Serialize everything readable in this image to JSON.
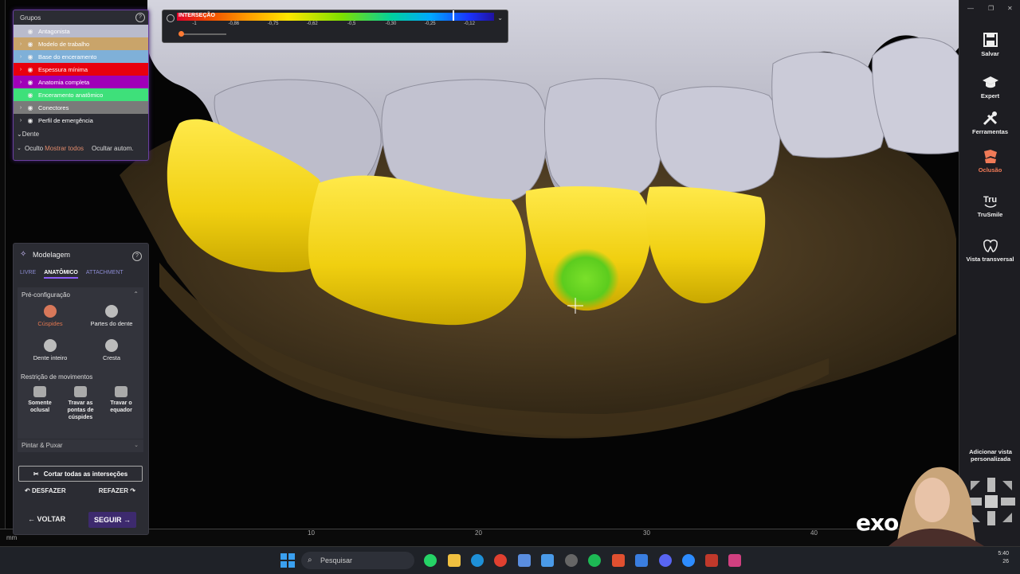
{
  "groups": {
    "title": "Grupos",
    "items": [
      {
        "label": "Antagonista",
        "color": "#b9bbcc",
        "expanded": false
      },
      {
        "label": "Modelo de trabalho",
        "color": "#c9a46a",
        "expanded": true
      },
      {
        "label": "Base do enceramento",
        "color": "#7fb0d8",
        "expanded": true
      },
      {
        "label": "Espessura mínima",
        "color": "#e8000e",
        "expanded": true
      },
      {
        "label": "Anatomia completa",
        "color": "#a000b8",
        "expanded": true
      },
      {
        "label": "Enceramento anatômico",
        "color": "#3ee07a",
        "expanded": false
      },
      {
        "label": "Conectores",
        "color": "#7a7a7a",
        "expanded": true
      },
      {
        "label": "Perfil de emergência",
        "color": "#2b2c33",
        "expanded": true
      }
    ],
    "dente": "Dente",
    "oculto": "Oculto",
    "show_all": "Mostrar todos",
    "auto_hide": "Ocultar autom."
  },
  "colorbar": {
    "label": "INTERSEÇÃO",
    "ticks": [
      "-1",
      "-0,86",
      "-0,75",
      "-0,62",
      "-0,5",
      "-0,30",
      "-0,25",
      "-0,12"
    ],
    "slider_value": 0.05
  },
  "modelagem": {
    "title": "Modelagem",
    "tabs": [
      {
        "label": "LIVRE",
        "active": false
      },
      {
        "label": "ANATÔMICO",
        "active": true
      },
      {
        "label": "ATTACHMENT",
        "active": false
      }
    ],
    "preconfig_title": "Pré-configuração",
    "tools": [
      {
        "label": "Cúspides",
        "selected": true
      },
      {
        "label": "Partes do dente",
        "selected": false
      },
      {
        "label": "Dente inteiro",
        "selected": false
      },
      {
        "label": "Cresta",
        "selected": false
      }
    ],
    "restriction_title": "Restrição de movimentos",
    "restrictions": [
      {
        "label": "Somente oclusal"
      },
      {
        "label": "Travar as pontas de cúspides"
      },
      {
        "label": "Travar o equador"
      }
    ],
    "paint_pull": "Pintar & Puxar",
    "cut_all": "Cortar todas as interseções",
    "undo": "DESFAZER",
    "redo": "REFAZER",
    "back": "VOLTAR",
    "next": "SEGUIR"
  },
  "right_toolbar": [
    {
      "label": "Salvar",
      "icon": "save-icon",
      "active": false
    },
    {
      "label": "Expert",
      "icon": "graduation-cap-icon",
      "active": false
    },
    {
      "label": "Ferramentas",
      "icon": "tools-icon",
      "active": false
    },
    {
      "label": "Oclusão",
      "icon": "occlusion-icon",
      "active": true
    },
    {
      "label": "TruSmile",
      "icon": "trusmile-icon",
      "active": false
    },
    {
      "label": "Vista transversal",
      "icon": "cross-section-icon",
      "active": false
    }
  ],
  "add_view": "Adicionar vista personalizada",
  "ruler_ticks": [
    "10",
    "20",
    "30",
    "40"
  ],
  "ruler_unit": "mm",
  "watermark": "exo",
  "taskbar": {
    "search_placeholder": "Pesquisar",
    "time": "5:40",
    "date": "26"
  },
  "colors": {
    "accent": "#8b5cf6",
    "active_tool": "#f07a57",
    "crown_yellow": "#f2d21a",
    "intersection_green": "#66d12a",
    "antagonist_gray": "#b8b8c6"
  }
}
